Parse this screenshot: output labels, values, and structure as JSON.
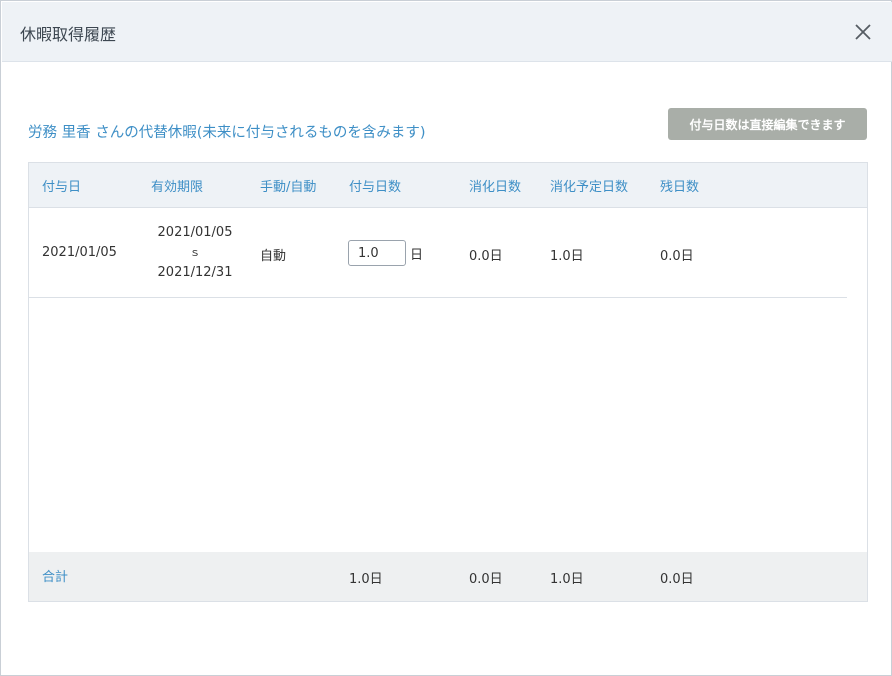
{
  "dialog": {
    "title": "休暇取得履歴",
    "close_icon": "close-icon"
  },
  "subtitle": "労務 里香 さんの代替休暇(未来に付与されるものを含みます)",
  "info_button": "付与日数は直接編集できます",
  "table": {
    "headers": [
      "付与日",
      "有効期限",
      "手動/自動",
      "付与日数",
      "消化日数",
      "消化予定日数",
      "残日数"
    ],
    "rows": [
      {
        "grant_date": "2021/01/05",
        "period_start": "2021/01/05",
        "period_sep": "ｓ",
        "period_end": "2021/12/31",
        "mode": "自動",
        "granted_days_value": "1.0",
        "granted_days_unit": "日",
        "used_days": "0.0日",
        "scheduled_days": "1.0日",
        "remaining_days": "0.0日"
      }
    ],
    "footer": {
      "label": "合計",
      "granted": "1.0日",
      "used": "0.0日",
      "scheduled": "1.0日",
      "remaining": "0.0日"
    }
  },
  "colors": {
    "accent": "#3e8fc6",
    "header_bg": "#eef2f6",
    "button_bg": "#a9aea8"
  }
}
